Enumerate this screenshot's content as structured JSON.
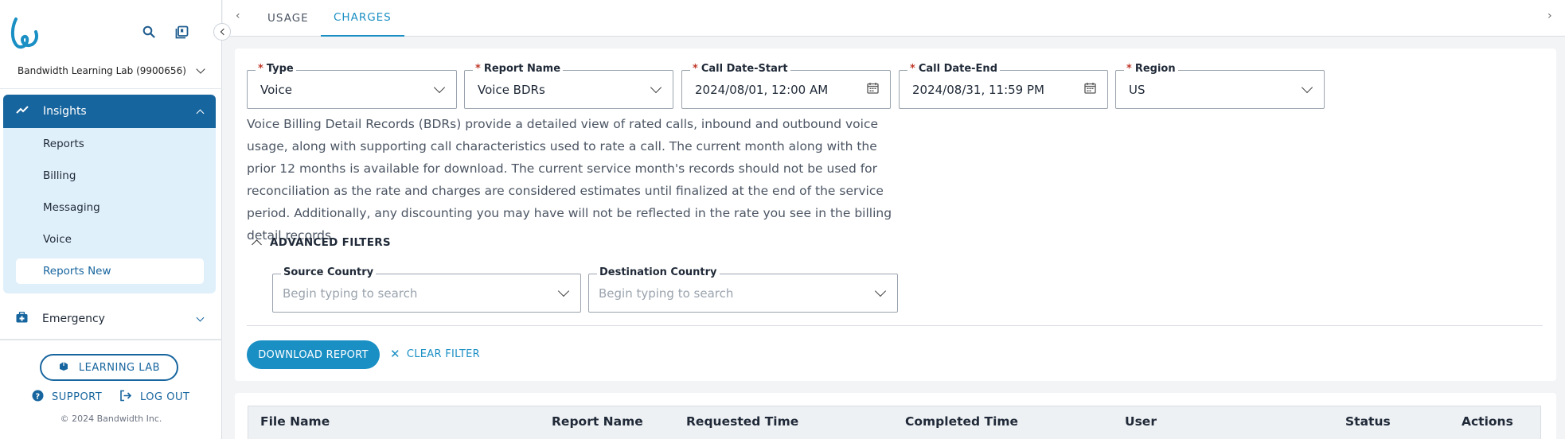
{
  "sidebar": {
    "account": "Bandwidth Learning Lab (9900656)",
    "nav": {
      "insights_label": "Insights",
      "items": [
        {
          "label": "Reports"
        },
        {
          "label": "Billing"
        },
        {
          "label": "Messaging"
        },
        {
          "label": "Voice"
        },
        {
          "label": "Reports New",
          "active": true
        }
      ],
      "emergency_label": "Emergency"
    },
    "learning_lab_label": "LEARNING LAB",
    "support_label": "SUPPORT",
    "logout_label": "LOG OUT",
    "copyright": "© 2024 Bandwidth Inc."
  },
  "tabs": [
    {
      "label": "USAGE",
      "active": false
    },
    {
      "label": "CHARGES",
      "active": true
    }
  ],
  "filters": {
    "type": {
      "label": "Type",
      "value": "Voice"
    },
    "report_name": {
      "label": "Report Name",
      "value": "Voice BDRs"
    },
    "call_date_start": {
      "label": "Call Date-Start",
      "value": "2024/08/01, 12:00 AM"
    },
    "call_date_end": {
      "label": "Call Date-End",
      "value": "2024/08/31, 11:59 PM"
    },
    "region": {
      "label": "Region",
      "value": "US"
    }
  },
  "description": "Voice Billing Detail Records (BDRs) provide a detailed view of rated calls, inbound and outbound voice usage, along with supporting call characteristics used to rate a call. The current month along with the prior 12 months is available for download. The current service month's records should not be used for reconciliation as the rate and charges are considered estimates until finalized at the end of the service period. Additionally, any discounting you may have will not be reflected in the rate you see in the billing detail records.",
  "advanced_filters": {
    "label": "ADVANCED FILTERS",
    "source_country": {
      "label": "Source Country",
      "placeholder": "Begin typing to search"
    },
    "destination_country": {
      "label": "Destination Country",
      "placeholder": "Begin typing to search"
    }
  },
  "actions": {
    "download_label": "DOWNLOAD REPORT",
    "clear_label": "CLEAR FILTER"
  },
  "table": {
    "columns": [
      "File Name",
      "Report Name",
      "Requested Time",
      "Completed Time",
      "User",
      "Status",
      "Actions"
    ]
  },
  "colors": {
    "primary": "#17659e",
    "accent": "#1a8fc4",
    "required": "#c0392b"
  }
}
